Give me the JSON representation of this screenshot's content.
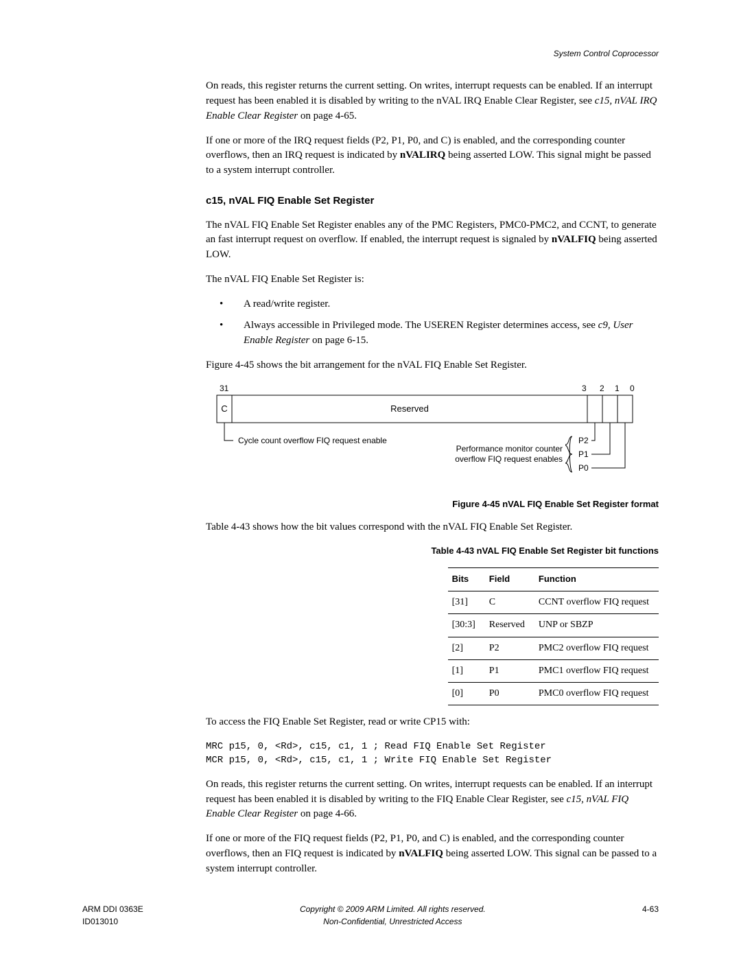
{
  "header": {
    "right": "System Control Coprocessor"
  },
  "p1_1": "On reads, this register returns the current setting. On writes, interrupt requests can be enabled. If an interrupt request has been enabled it is disabled by writing to the nVAL IRQ Enable Clear Register, see ",
  "p1_i": "c15, nVAL IRQ Enable Clear Register",
  "p1_2": " on page 4-65.",
  "p2_1": "If one or more of the IRQ request fields (P2, P1, P0, and C) is enabled, and the corresponding counter overflows, then an IRQ request is indicated by ",
  "p2_b": "nVALIRQ",
  "p2_2": " being asserted LOW. This signal might be passed to a system interrupt controller.",
  "h3": "c15, nVAL FIQ Enable Set Register",
  "p3_1": "The nVAL FIQ Enable Set Register enables any of the PMC Registers, PMC0-PMC2, and CCNT, to generate an fast interrupt request on overflow. If enabled, the interrupt request is signaled by ",
  "p3_b": "nVALFIQ",
  "p3_2": " being asserted LOW.",
  "p4": "The nVAL FIQ Enable Set Register is:",
  "b1": "A read/write register.",
  "b2_1": "Always accessible in Privileged mode. The USEREN Register determines access, see ",
  "b2_i": "c9, User Enable Register",
  "b2_2": " on page 6-15.",
  "p5": "Figure 4-45 shows the bit arrangement for the nVAL FIQ Enable Set Register.",
  "fig": {
    "bit31": "31",
    "bit3": "3",
    "bit2": "2",
    "bit1": "1",
    "bit0": "0",
    "C": "C",
    "Reserved": "Reserved",
    "cycle_label": "Cycle count overflow FIQ request enable",
    "pm_label1": "Performance monitor counter",
    "pm_label2": "overflow FIQ request enables",
    "P2": "P2",
    "P1": "P1",
    "P0": "P0"
  },
  "fig_title": "Figure 4-45 nVAL FIQ Enable Set Register format",
  "p6": "Table 4-43 shows how the bit values correspond with the nVAL FIQ Enable Set Register.",
  "table_title": "Table 4-43 nVAL FIQ Enable Set Register bit functions",
  "th": {
    "bits": "Bits",
    "field": "Field",
    "function": "Function"
  },
  "rows": [
    {
      "bits": "[31]",
      "field": "C",
      "function": "CCNT overflow FIQ request"
    },
    {
      "bits": "[30:3]",
      "field": "Reserved",
      "function": "UNP or SBZP"
    },
    {
      "bits": "[2]",
      "field": "P2",
      "function": "PMC2 overflow FIQ request"
    },
    {
      "bits": "[1]",
      "field": "P1",
      "function": "PMC1 overflow FIQ request"
    },
    {
      "bits": "[0]",
      "field": "P0",
      "function": "PMC0 overflow FIQ request"
    }
  ],
  "p7": "To access the FIQ Enable Set Register, read or write CP15 with:",
  "code": "MRC p15, 0, <Rd>, c15, c1, 1 ; Read FIQ Enable Set Register\nMCR p15, 0, <Rd>, c15, c1, 1 ; Write FIQ Enable Set Register",
  "p8_1": "On reads, this register returns the current setting. On writes, interrupt requests can be enabled. If an interrupt request has been enabled it is disabled by writing to the FIQ Enable Clear Register, see ",
  "p8_i": "c15, nVAL FIQ Enable Clear Register",
  "p8_2": " on page 4-66.",
  "p9_1": "If one or more of the FIQ request fields (P2, P1, P0, and C) is enabled, and the corresponding counter overflows, then an FIQ request is indicated by ",
  "p9_b": "nVALFIQ",
  "p9_2": " being asserted LOW. This signal can be passed to a system interrupt controller.",
  "footer": {
    "left1": "ARM DDI 0363E",
    "left2": "ID013010",
    "center1": "Copyright © 2009 ARM Limited. All rights reserved.",
    "center2": "Non-Confidential, Unrestricted Access",
    "right": "4-63"
  }
}
